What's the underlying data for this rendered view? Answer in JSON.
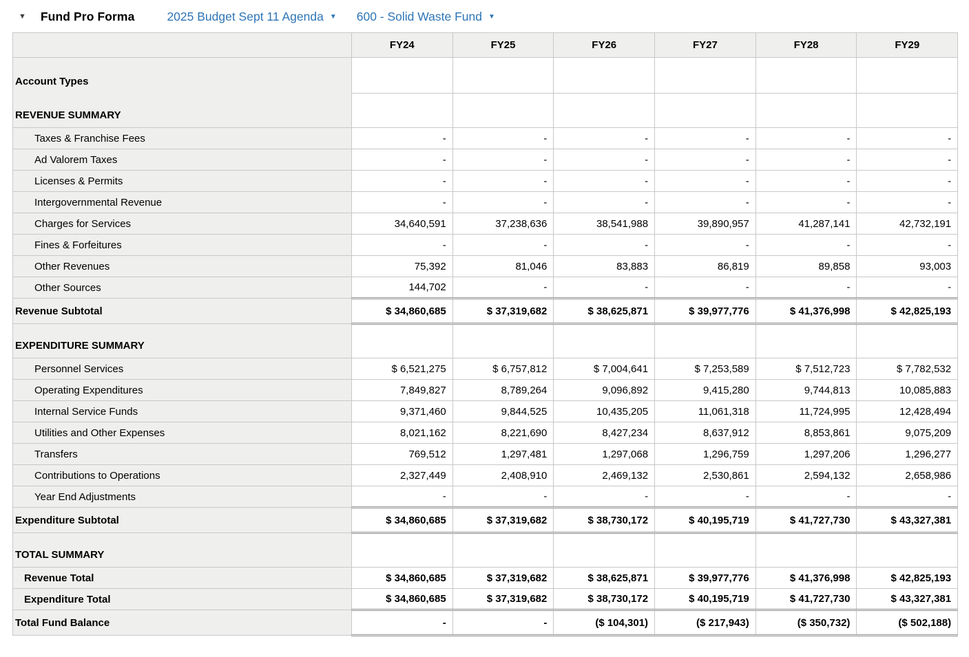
{
  "titlebar": {
    "collapse_icon": "▼",
    "title": "Fund Pro Forma",
    "budget_dropdown": "2025 Budget Sept 11 Agenda",
    "fund_dropdown": "600 - Solid Waste Fund",
    "dropdown_arrow_icon": "▼",
    "link_color": "#2e75b5"
  },
  "table": {
    "columns": [
      "FY24",
      "FY25",
      "FY26",
      "FY27",
      "FY28",
      "FY29"
    ],
    "rows": [
      {
        "type": "account",
        "label": "Account Types",
        "values": [
          "",
          "",
          "",
          "",
          "",
          ""
        ]
      },
      {
        "type": "section",
        "label": "REVENUE SUMMARY",
        "values": [
          "",
          "",
          "",
          "",
          "",
          ""
        ]
      },
      {
        "type": "detail",
        "label": "Taxes & Franchise Fees",
        "values": [
          "-",
          "-",
          "-",
          "-",
          "-",
          "-"
        ]
      },
      {
        "type": "detail",
        "label": "Ad Valorem Taxes",
        "values": [
          "-",
          "-",
          "-",
          "-",
          "-",
          "-"
        ]
      },
      {
        "type": "detail",
        "label": "Licenses & Permits",
        "values": [
          "-",
          "-",
          "-",
          "-",
          "-",
          "-"
        ]
      },
      {
        "type": "detail",
        "label": "Intergovernmental Revenue",
        "values": [
          "-",
          "-",
          "-",
          "-",
          "-",
          "-"
        ]
      },
      {
        "type": "detail",
        "label": "Charges for Services",
        "values": [
          "34,640,591",
          "37,238,636",
          "38,541,988",
          "39,890,957",
          "41,287,141",
          "42,732,191"
        ]
      },
      {
        "type": "detail",
        "label": "Fines & Forfeitures",
        "values": [
          "-",
          "-",
          "-",
          "-",
          "-",
          "-"
        ]
      },
      {
        "type": "detail",
        "label": "Other Revenues",
        "values": [
          "75,392",
          "81,046",
          "83,883",
          "86,819",
          "89,858",
          "93,003"
        ]
      },
      {
        "type": "detail",
        "label": "Other Sources",
        "values": [
          "144,702",
          "-",
          "-",
          "-",
          "-",
          "-"
        ]
      },
      {
        "type": "subtotal",
        "label": "Revenue Subtotal",
        "values": [
          "$ 34,860,685",
          "$ 37,319,682",
          "$ 38,625,871",
          "$ 39,977,776",
          "$ 41,376,998",
          "$ 42,825,193"
        ]
      },
      {
        "type": "section",
        "label": "EXPENDITURE SUMMARY",
        "values": [
          "",
          "",
          "",
          "",
          "",
          ""
        ]
      },
      {
        "type": "detail",
        "label": "Personnel Services",
        "values": [
          "$ 6,521,275",
          "$ 6,757,812",
          "$ 7,004,641",
          "$ 7,253,589",
          "$ 7,512,723",
          "$ 7,782,532"
        ]
      },
      {
        "type": "detail",
        "label": "Operating Expenditures",
        "values": [
          "7,849,827",
          "8,789,264",
          "9,096,892",
          "9,415,280",
          "9,744,813",
          "10,085,883"
        ]
      },
      {
        "type": "detail",
        "label": "Internal Service Funds",
        "values": [
          "9,371,460",
          "9,844,525",
          "10,435,205",
          "11,061,318",
          "11,724,995",
          "12,428,494"
        ]
      },
      {
        "type": "detail",
        "label": "Utilities and Other Expenses",
        "values": [
          "8,021,162",
          "8,221,690",
          "8,427,234",
          "8,637,912",
          "8,853,861",
          "9,075,209"
        ]
      },
      {
        "type": "detail",
        "label": "Transfers",
        "values": [
          "769,512",
          "1,297,481",
          "1,297,068",
          "1,296,759",
          "1,297,206",
          "1,296,277"
        ]
      },
      {
        "type": "detail",
        "label": "Contributions to Operations",
        "values": [
          "2,327,449",
          "2,408,910",
          "2,469,132",
          "2,530,861",
          "2,594,132",
          "2,658,986"
        ]
      },
      {
        "type": "detail",
        "label": "Year End Adjustments",
        "values": [
          "-",
          "-",
          "-",
          "-",
          "-",
          "-"
        ]
      },
      {
        "type": "subtotal",
        "label": "Expenditure Subtotal",
        "values": [
          "$ 34,860,685",
          "$ 37,319,682",
          "$ 38,730,172",
          "$ 40,195,719",
          "$ 41,727,730",
          "$ 43,327,381"
        ]
      },
      {
        "type": "section",
        "label": "TOTAL SUMMARY",
        "values": [
          "",
          "",
          "",
          "",
          "",
          ""
        ]
      },
      {
        "type": "totalitem",
        "label": "Revenue Total",
        "values": [
          "$ 34,860,685",
          "$ 37,319,682",
          "$ 38,625,871",
          "$ 39,977,776",
          "$ 41,376,998",
          "$ 42,825,193"
        ]
      },
      {
        "type": "totalitem",
        "label": "Expenditure Total",
        "values": [
          "$ 34,860,685",
          "$ 37,319,682",
          "$ 38,730,172",
          "$ 40,195,719",
          "$ 41,727,730",
          "$ 43,327,381"
        ]
      },
      {
        "type": "grand",
        "label": "Total Fund Balance",
        "values": [
          "-",
          "-",
          "($ 104,301)",
          "($ 217,943)",
          "($ 350,732)",
          "($ 502,188)"
        ]
      }
    ]
  }
}
